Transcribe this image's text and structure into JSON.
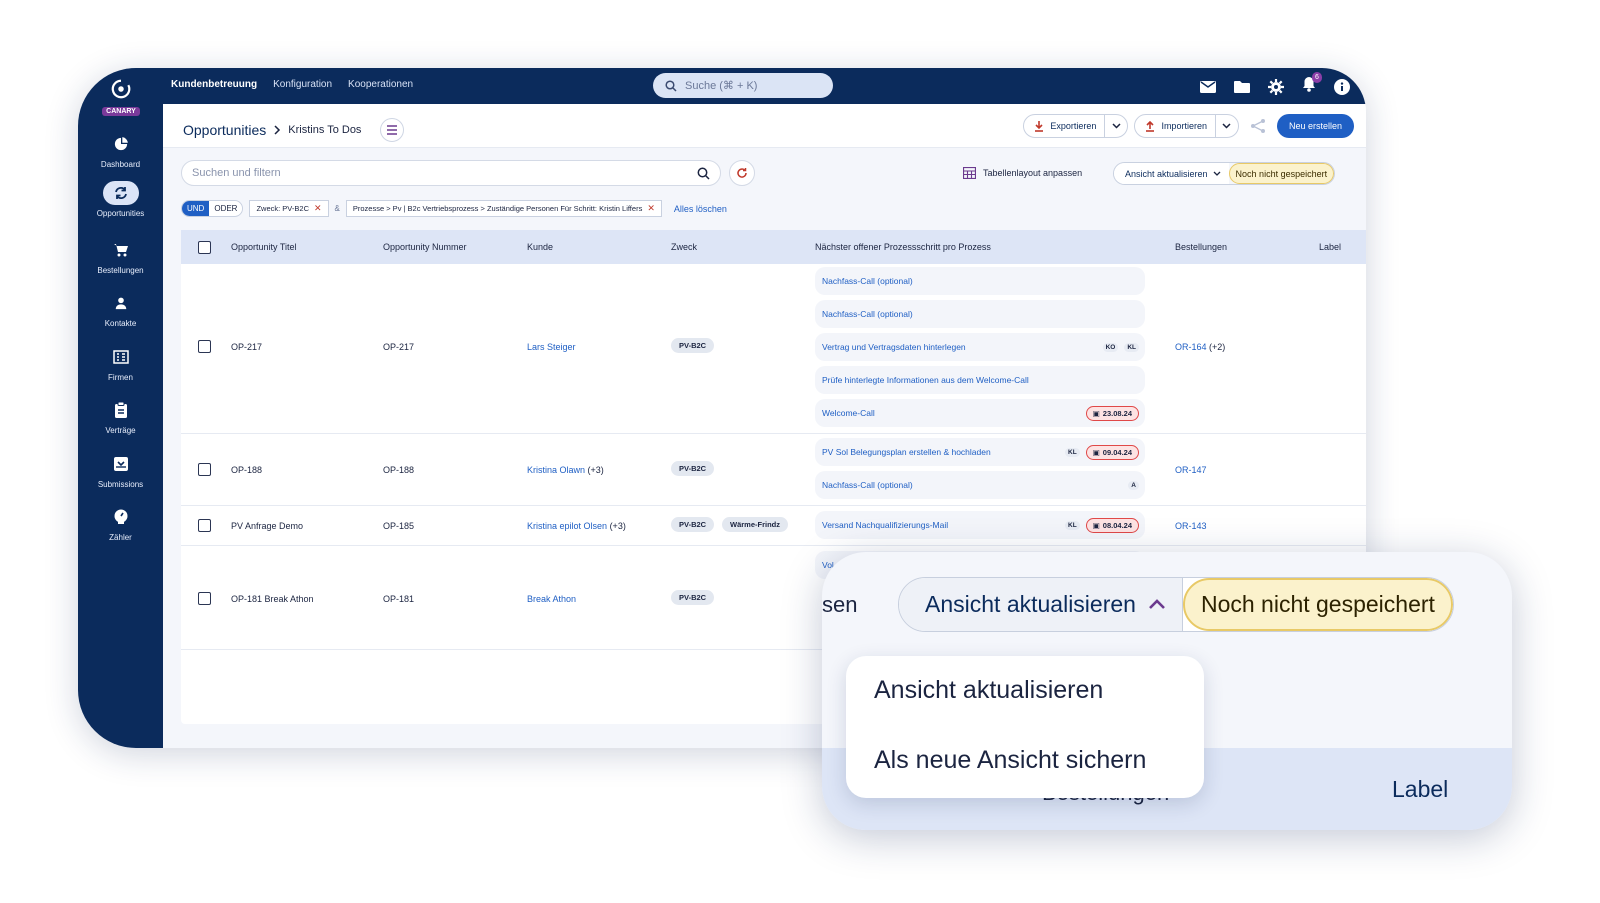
{
  "app": {
    "logo_tag": "CANARY",
    "top_nav": [
      "Kundenbetreuung",
      "Konfiguration",
      "Kooperationen"
    ],
    "search_placeholder": "Suche (⌘ + K)",
    "notification_count": "6"
  },
  "sidebar": {
    "items": [
      {
        "label": "Dashboard",
        "icon": "pie-chart-icon"
      },
      {
        "label": "Opportunities",
        "icon": "refresh-icon"
      },
      {
        "label": "Bestellungen",
        "icon": "cart-icon"
      },
      {
        "label": "Kontakte",
        "icon": "person-icon"
      },
      {
        "label": "Firmen",
        "icon": "building-icon"
      },
      {
        "label": "Verträge",
        "icon": "clipboard-icon"
      },
      {
        "label": "Submissions",
        "icon": "inbox-icon"
      },
      {
        "label": "Zähler",
        "icon": "meter-icon"
      }
    ],
    "active": "Opportunities"
  },
  "header": {
    "title": "Opportunities",
    "sub": "Kristins To Dos",
    "export": "Exportieren",
    "import": "Importieren",
    "create": "Neu erstellen"
  },
  "filter": {
    "placeholder": "Suchen und filtern",
    "layout_label": "Tabellenlayout anpassen",
    "view_label": "Ansicht aktualisieren",
    "unsaved": "Noch nicht gespeichert",
    "toggle_and": "UND",
    "toggle_or": "ODER",
    "chip1": "Zweck: PV-B2C",
    "amp": "&",
    "chip2": "Prozesse > Pv | B2c Vertriebsprozess > Zuständige Personen Für Schritt: Kristin Liffers",
    "clear_all": "Alles löschen"
  },
  "table": {
    "columns": [
      "Opportunity Titel",
      "Opportunity Nummer",
      "Kunde",
      "Zweck",
      "Nächster offener Prozessschritt pro Prozess",
      "Bestellungen",
      "Label"
    ],
    "rows": [
      {
        "title": "OP-217",
        "number": "OP-217",
        "customer": "Lars Steiger",
        "extra": "",
        "zweck": "PV-B2C",
        "zweck2": "",
        "orders": "OR-164",
        "orders_extra": "(+2)",
        "steps": [
          {
            "text": "Nachfass-Call (optional)",
            "tags": [],
            "date": ""
          },
          {
            "text": "Nachfass-Call (optional)",
            "tags": [],
            "date": ""
          },
          {
            "text": "Vertrag und Vertragsdaten hinterlegen",
            "tags": [
              "KO",
              "KL"
            ],
            "date": ""
          },
          {
            "text": "Prüfe hinterlegte Informationen aus dem Welcome-Call",
            "tags": [],
            "date": ""
          },
          {
            "text": "Welcome-Call",
            "tags": [],
            "date": "23.08.24"
          }
        ]
      },
      {
        "title": "OP-188",
        "number": "OP-188",
        "customer": "Kristina Olawn",
        "extra": "(+3)",
        "zweck": "PV-B2C",
        "zweck2": "",
        "orders": "OR-147",
        "orders_extra": "",
        "steps": [
          {
            "text": "PV Sol Belegungsplan erstellen & hochladen",
            "tags": [
              "KL"
            ],
            "date": "09.04.24"
          },
          {
            "text": "Nachfass-Call (optional)",
            "tags": [
              "A"
            ],
            "date": ""
          }
        ]
      },
      {
        "title": "PV Anfrage Demo",
        "number": "OP-185",
        "customer": "Kristina epilot Olsen",
        "extra": "(+3)",
        "zweck": "PV-B2C",
        "zweck2": "Wärme-Frindz",
        "orders": "OR-143",
        "orders_extra": "",
        "steps": [
          {
            "text": "Versand Nachqualifizierungs-Mail",
            "tags": [
              "KL"
            ],
            "date": "08.04.24"
          }
        ]
      },
      {
        "title": "OP-181 Break Athon",
        "number": "OP-181",
        "customer": "Break Athon",
        "extra": "",
        "zweck": "PV-B2C",
        "zweck2": "",
        "orders": "",
        "orders_extra": "",
        "steps": [
          {
            "text": "Vol",
            "tags": [],
            "date": ""
          }
        ]
      }
    ]
  },
  "zoom": {
    "cut_text": "sen",
    "view_label": "Ansicht aktualisieren",
    "unsaved": "Noch nicht gespeichert",
    "option1": "Ansicht aktualisieren",
    "option2": "Als neue Ansicht sichern",
    "bg_label": "Label",
    "bg_cut": "Bestellungen"
  }
}
